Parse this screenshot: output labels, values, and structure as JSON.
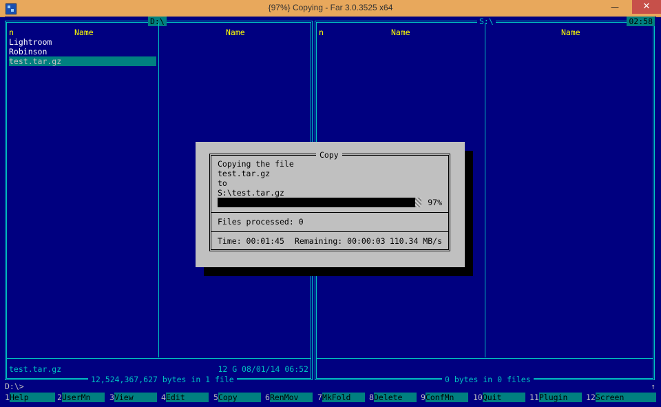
{
  "window": {
    "title": "{97%} Copying - Far 3.0.3525 x64",
    "minimize": "—",
    "maximize": "❐",
    "close": "✕"
  },
  "left_panel": {
    "path": "D:\\",
    "col_n": "n",
    "col1": "Name",
    "col2": "Name",
    "files": [
      "Lightroom",
      "Robinson",
      "test.tar.gz"
    ],
    "selected_index": 2,
    "info_name": "test.tar.gz",
    "info_meta": "12 G 08/01/14 06:52",
    "summary": "12,524,367,627 bytes in 1 file"
  },
  "right_panel": {
    "path": "S:\\",
    "clock": "02:58",
    "col_n": "n",
    "col1": "Name",
    "col2": "Name",
    "summary": "0 bytes in 0 files"
  },
  "command_line": "D:\\>",
  "scroll_arrow": "↑",
  "keybar": [
    {
      "num": "1",
      "label": "Help"
    },
    {
      "num": "2",
      "label": "UserMn"
    },
    {
      "num": "3",
      "label": "View"
    },
    {
      "num": "4",
      "label": "Edit"
    },
    {
      "num": "5",
      "label": "Copy"
    },
    {
      "num": "6",
      "label": "RenMov"
    },
    {
      "num": "7",
      "label": "MkFold"
    },
    {
      "num": "8",
      "label": "Delete"
    },
    {
      "num": "9",
      "label": "ConfMn"
    },
    {
      "num": "10",
      "label": "Quit"
    },
    {
      "num": "11",
      "label": "Plugin"
    },
    {
      "num": "12",
      "label": "Screen"
    }
  ],
  "copy_dialog": {
    "title": "Copy",
    "line1": "Copying the file",
    "source": "test.tar.gz",
    "to": "to",
    "destination": "S:\\test.tar.gz",
    "progress": 0.97,
    "percent": "97%",
    "files_processed": "Files processed: 0",
    "time": "Time: 00:01:45",
    "remaining": "Remaining: 00:00:03",
    "speed": "110.34 MB/s"
  }
}
